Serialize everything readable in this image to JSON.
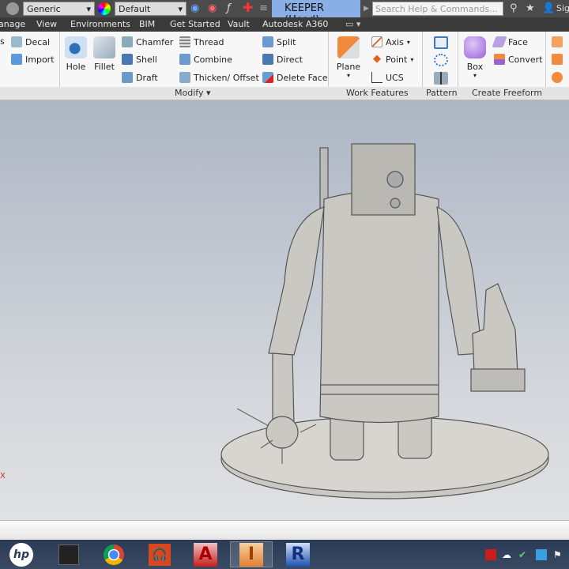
{
  "titlebar": {
    "material": "Generic",
    "appearance": "Default",
    "document_title": "KEEPER (Head)",
    "search_placeholder": "Search Help & Commands...",
    "sign_in": "Sig"
  },
  "menu": [
    "anage",
    "View",
    "Environments",
    "BIM",
    "Get Started",
    "Vault",
    "Autodesk A360"
  ],
  "ribbon": {
    "insert": {
      "decal": "Decal",
      "import": "Import",
      "cut": "s"
    },
    "modify": {
      "hole": "Hole",
      "fillet": "Fillet",
      "chamfer": "Chamfer",
      "shell": "Shell",
      "draft": "Draft",
      "thread": "Thread",
      "combine": "Combine",
      "thicken": "Thicken/ Offset",
      "split": "Split",
      "direct": "Direct",
      "delete_face": "Delete Face",
      "label": "Modify ▾"
    },
    "work_features": {
      "plane": "Plane",
      "axis": "Axis",
      "point": "Point",
      "ucs": "UCS",
      "label": "Work Features"
    },
    "pattern": {
      "label": "Pattern"
    },
    "freeform": {
      "box": "Box",
      "face": "Face",
      "convert": "Convert",
      "label": "Create Freeform"
    }
  },
  "viewport": {
    "axis_label": "X"
  },
  "taskbar": {
    "apps": [
      "hp",
      "touch",
      "chrome",
      "music",
      "autocad",
      "inventor",
      "revit"
    ],
    "active": "inventor"
  },
  "colors": {
    "title_highlight": "#8aaee6",
    "taskbar": "#2c3b55",
    "viewport_top": "#adb6c4"
  }
}
